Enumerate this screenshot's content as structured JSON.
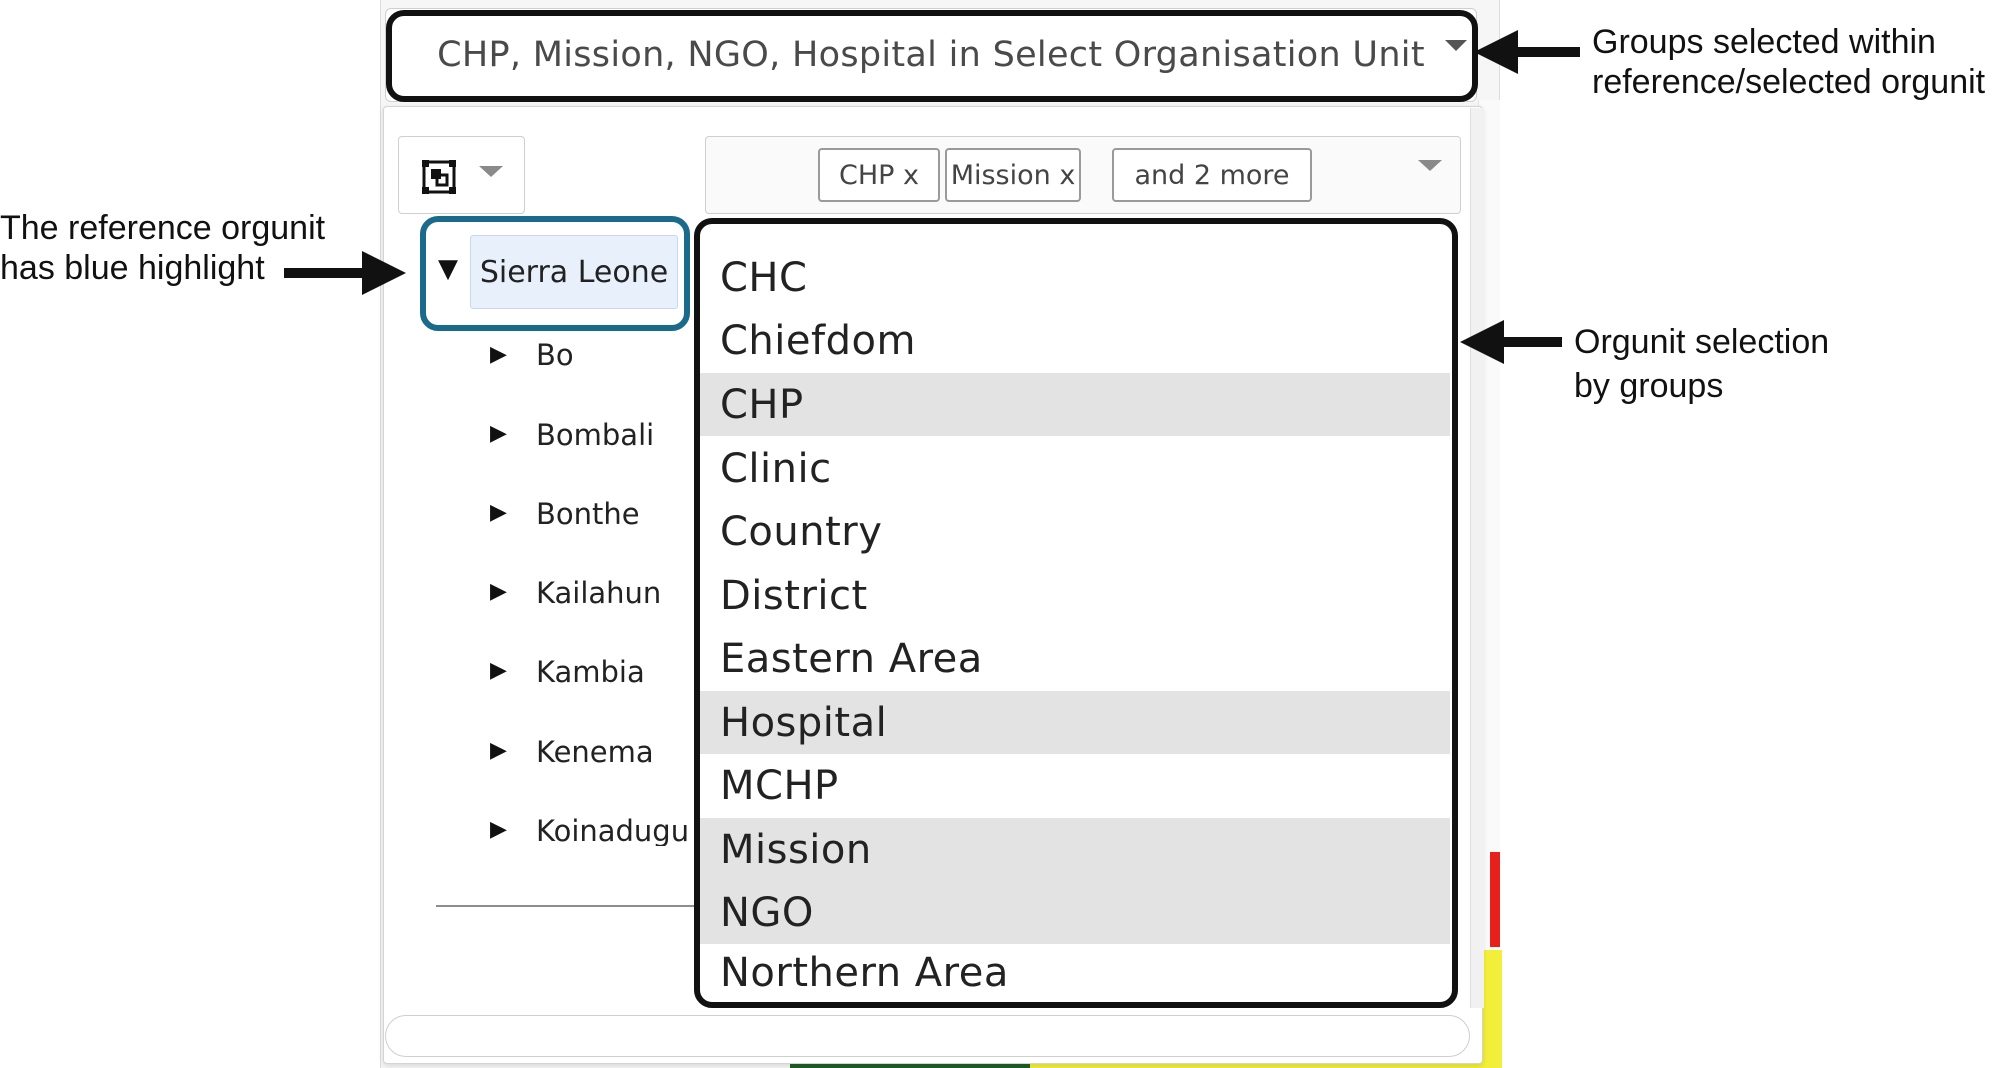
{
  "top_select": {
    "label": "CHP, Mission, NGO, Hospital in Select Organisation Unit"
  },
  "level_selector": {
    "icon": "level-icon"
  },
  "group_selector": {
    "chips": [
      "CHP x",
      "Mission x",
      "and 2 more"
    ]
  },
  "tree": {
    "root": "Sierra Leone",
    "children": [
      "Bo",
      "Bombali",
      "Bonthe",
      "Kailahun",
      "Kambia",
      "Kenema",
      "Koinadugu"
    ]
  },
  "groups_list": {
    "items": [
      {
        "label": "CHC",
        "selected": false
      },
      {
        "label": "Chiefdom",
        "selected": false
      },
      {
        "label": "CHP",
        "selected": true
      },
      {
        "label": "Clinic",
        "selected": false
      },
      {
        "label": "Country",
        "selected": false
      },
      {
        "label": "District",
        "selected": false
      },
      {
        "label": "Eastern Area",
        "selected": false
      },
      {
        "label": "Hospital",
        "selected": true
      },
      {
        "label": "MCHP",
        "selected": false
      },
      {
        "label": "Mission",
        "selected": true
      },
      {
        "label": "NGO",
        "selected": true
      },
      {
        "label": "Northern Area",
        "selected": false
      }
    ]
  },
  "annotations": {
    "groups_selected": [
      "Groups selected within",
      "reference/selected orgunit"
    ],
    "reference_orgunit": [
      "The reference orgunit",
      "has blue highlight"
    ],
    "orgunit_selection": [
      "Orgunit selection",
      "by groups"
    ]
  },
  "colors": {
    "reference_highlight_border": "#1a6a8c",
    "reference_highlight_fill": "#e8f1fb",
    "selected_row": "#e3e3e3",
    "callout": "#111111"
  }
}
